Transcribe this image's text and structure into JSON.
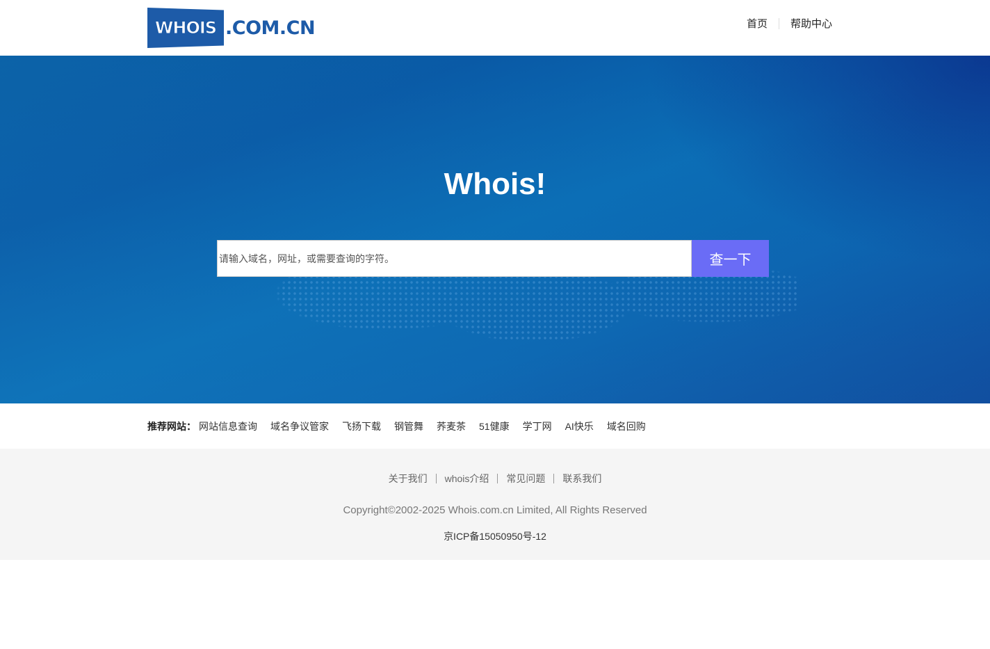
{
  "header": {
    "logo_text": "WHOIS",
    "logo_domain": ".COM.CN",
    "nav": [
      {
        "label": "首页"
      },
      {
        "label": "帮助中心"
      }
    ]
  },
  "hero": {
    "title": "Whois!",
    "search": {
      "placeholder": "请输入域名，网址，或需要查询的字符。",
      "value": "",
      "button_label": "查一下"
    }
  },
  "recommend": {
    "label": "推荐网站：",
    "links": [
      "网站信息查询",
      "域名争议管家",
      "飞扬下载",
      "钢管舞",
      "荞麦茶",
      "51健康",
      "学丁网",
      "AI快乐",
      "域名回购"
    ]
  },
  "footer": {
    "links": [
      "关于我们",
      "whois介绍",
      "常见问题",
      "联系我们"
    ],
    "copyright": "Copyright©2002-2025 Whois.com.cn Limited, All Rights Reserved",
    "icp": "京ICP备15050950号-12"
  },
  "colors": {
    "brand": "#1d5ba8",
    "search_button": "#6a6cf6",
    "hero_start": "#0c63a8",
    "hero_end": "#0d3a92"
  }
}
